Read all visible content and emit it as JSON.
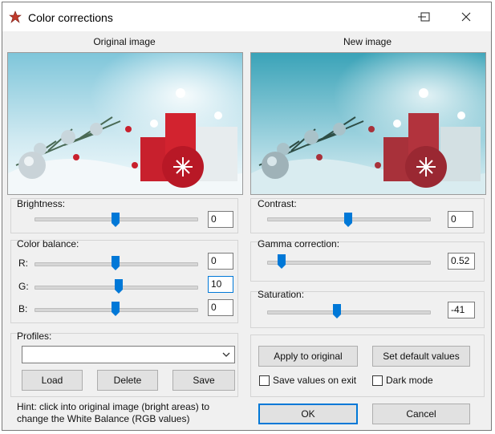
{
  "window": {
    "title": "Color corrections",
    "controls": {
      "minimize": "—",
      "maximize": "☐",
      "close": "✕"
    }
  },
  "captions": {
    "original": "Original image",
    "new": "New image"
  },
  "left": {
    "brightness": {
      "label": "Brightness:",
      "value": "0",
      "level": 0.5
    },
    "color_balance": {
      "label": "Color balance:",
      "r": {
        "label": "R:",
        "value": "0",
        "level": 0.5
      },
      "g": {
        "label": "G:",
        "value": "10",
        "level": 0.52
      },
      "b": {
        "label": "B:",
        "value": "0",
        "level": 0.5
      }
    },
    "profiles": {
      "label": "Profiles:",
      "selected": "",
      "load": "Load",
      "delete": "Delete",
      "save": "Save"
    },
    "hint": "Hint: click into original image (bright areas) to change the White Balance (RGB values)"
  },
  "right": {
    "contrast": {
      "label": "Contrast:",
      "value": "0",
      "level": 0.5
    },
    "gamma": {
      "label": "Gamma correction:",
      "value": "0.52",
      "level": 0.09
    },
    "saturation": {
      "label": "Saturation:",
      "value": "-41",
      "level": 0.43
    },
    "apply": "Apply to original",
    "set_default": "Set default values",
    "save_on_exit": {
      "label": "Save values on exit",
      "checked": false
    },
    "dark_mode": {
      "label": "Dark mode",
      "checked": false
    },
    "ok": "OK",
    "cancel": "Cancel"
  },
  "colors": {
    "accent": "#0078d7",
    "thumb": "#0078d7"
  }
}
